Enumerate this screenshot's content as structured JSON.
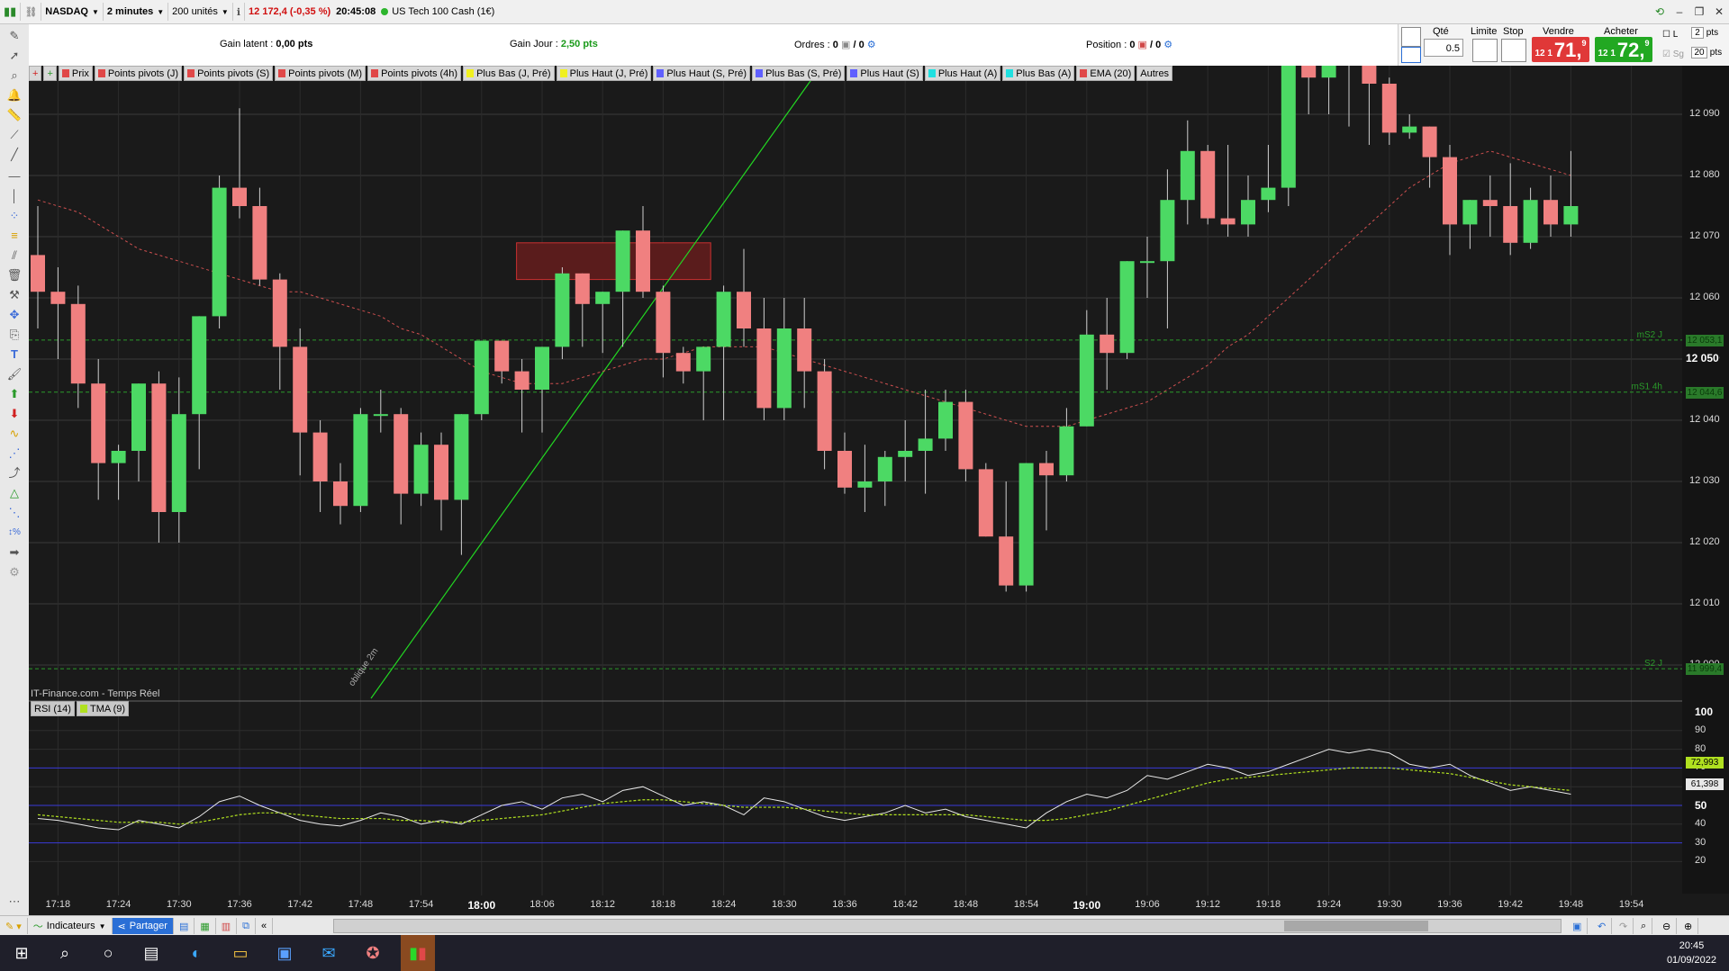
{
  "topbar": {
    "exchange": "NASDAQ",
    "timeframe": "2 minutes",
    "units": "200 unités",
    "price_change": "12 172,4 (-0,35 %)",
    "time": "20:45:08",
    "instrument": "US Tech 100 Cash (1€)"
  },
  "infobar": {
    "gain_latent_label": "Gain latent :",
    "gain_latent_value": "0,00 pts",
    "gain_jour_label": "Gain Jour :",
    "gain_jour_value": "2,50 pts",
    "ordres_label": "Ordres :",
    "ordres_value1": "0",
    "ordres_value2": "/ 0",
    "position_label": "Position :",
    "position_value1": "0",
    "position_value2": "/ 0"
  },
  "order_panel": {
    "qte_label": "Qté",
    "qte_value": "0.5",
    "limite_label": "Limite",
    "stop_label": "Stop",
    "vendre_label": "Vendre",
    "acheter_label": "Acheter",
    "sell_small": "12 1",
    "sell_big": "71,",
    "sell_sup": "9",
    "buy_small": "12 1",
    "buy_big": "72,",
    "buy_sup": "9",
    "opt_l": "L",
    "opt_sg": "Sg",
    "pts1_value": "2",
    "pts1_label": "pts",
    "pts2_value": "20",
    "pts2_label": "pts"
  },
  "tags": [
    {
      "label": "Prix",
      "color": "#e04848"
    },
    {
      "label": "Points pivots (J)",
      "color": "#e04848"
    },
    {
      "label": "Points pivots (S)",
      "color": "#e04848"
    },
    {
      "label": "Points pivots (M)",
      "color": "#e04848"
    },
    {
      "label": "Points pivots (4h)",
      "color": "#e04848"
    },
    {
      "label": "Plus Bas (J, Pré)",
      "color": "#f0f020"
    },
    {
      "label": "Plus Haut (J, Pré)",
      "color": "#f0f020"
    },
    {
      "label": "Plus Haut (S, Pré)",
      "color": "#6060ff"
    },
    {
      "label": "Plus Bas (S, Pré)",
      "color": "#6060ff"
    },
    {
      "label": "Plus Haut (S)",
      "color": "#6060ff"
    },
    {
      "label": "Plus Haut (A)",
      "color": "#20e0e0"
    },
    {
      "label": "Plus Bas (A)",
      "color": "#20e0e0"
    },
    {
      "label": "EMA (20)",
      "color": "#e04848"
    },
    {
      "label": "Autres",
      "color": ""
    }
  ],
  "chart": {
    "watermark": "IT-Finance.com - Temps Réel",
    "line_label": "oblique 2m",
    "level_labels": [
      "mS2 J",
      "mS1 4h",
      "S2 J"
    ],
    "price_badges": [
      "12 053,1",
      "12 044,6",
      "11 999,4"
    ],
    "y_labels": [
      "12 090",
      "12 080",
      "12 070",
      "12 060",
      "12 050",
      "12 040",
      "12 030",
      "12 020",
      "12 010",
      "12 000"
    ],
    "rsi_labels": [
      "100",
      "90",
      "80",
      "70",
      "60",
      "50",
      "40",
      "30",
      "20"
    ],
    "rsi_badges": [
      "72,993",
      "61,398"
    ],
    "x_labels": [
      "17:18",
      "17:24",
      "17:30",
      "17:36",
      "17:42",
      "17:48",
      "17:54",
      "18:00",
      "18:06",
      "18:12",
      "18:18",
      "18:24",
      "18:30",
      "18:36",
      "18:42",
      "18:48",
      "18:54",
      "19:00",
      "19:06",
      "19:12",
      "19:18",
      "19:24",
      "19:30",
      "19:36",
      "19:42",
      "19:48",
      "19:54"
    ],
    "bold_x": [
      "18:00",
      "19:00"
    ]
  },
  "rsi_tags": [
    {
      "label": "RSI (14)",
      "color": ""
    },
    {
      "label": "TMA (9)",
      "color": "#b0e020"
    }
  ],
  "bottombar": {
    "indicateurs": "Indicateurs",
    "partager": "Partager"
  },
  "taskbar": {
    "time": "20:45",
    "date": "01/09/2022"
  },
  "colors": {
    "bull": "#4cd964",
    "bear": "#f08080",
    "sell": "#e03838",
    "buy": "#22a822"
  },
  "chart_data": {
    "type": "candlestick",
    "x_start": "17:16",
    "interval_minutes": 2,
    "ylim": [
      11995,
      12095
    ],
    "candles": [
      [
        12067,
        12075,
        12055,
        12061
      ],
      [
        12061,
        12065,
        12050,
        12059
      ],
      [
        12059,
        12062,
        12042,
        12046
      ],
      [
        12046,
        12050,
        12027,
        12033
      ],
      [
        12033,
        12036,
        12027,
        12035
      ],
      [
        12035,
        12045,
        12030,
        12046
      ],
      [
        12046,
        12048,
        12020,
        12025
      ],
      [
        12025,
        12047,
        12020,
        12041
      ],
      [
        12041,
        12053,
        12032,
        12057
      ],
      [
        12057,
        12080,
        12055,
        12078
      ],
      [
        12078,
        12091,
        12073,
        12075
      ],
      [
        12075,
        12078,
        12062,
        12063
      ],
      [
        12063,
        12064,
        12045,
        12052
      ],
      [
        12052,
        12055,
        12031,
        12038
      ],
      [
        12038,
        12040,
        12025,
        12030
      ],
      [
        12030,
        12033,
        12023,
        12026
      ],
      [
        12026,
        12042,
        12025,
        12041
      ],
      [
        12041,
        12045,
        12038,
        12041
      ],
      [
        12041,
        12042,
        12023,
        12028
      ],
      [
        12028,
        12038,
        12026,
        12036
      ],
      [
        12036,
        12038,
        12022,
        12027
      ],
      [
        12027,
        12040,
        12018,
        12041
      ],
      [
        12041,
        12052,
        12040,
        12053
      ],
      [
        12053,
        12052,
        12046,
        12048
      ],
      [
        12048,
        12050,
        12038,
        12045
      ],
      [
        12045,
        12050,
        12038,
        12052
      ],
      [
        12052,
        12065,
        12050,
        12064
      ],
      [
        12064,
        12064,
        12052,
        12059
      ],
      [
        12059,
        12060,
        12051,
        12061
      ],
      [
        12061,
        12068,
        12052,
        12071
      ],
      [
        12071,
        12075,
        12060,
        12061
      ],
      [
        12061,
        12062,
        12047,
        12051
      ],
      [
        12051,
        12052,
        12046,
        12048
      ],
      [
        12048,
        12050,
        12040,
        12052
      ],
      [
        12052,
        12062,
        12040,
        12061
      ],
      [
        12061,
        12068,
        12052,
        12055
      ],
      [
        12055,
        12060,
        12040,
        12042
      ],
      [
        12042,
        12060,
        12040,
        12055
      ],
      [
        12055,
        12060,
        12042,
        12048
      ],
      [
        12048,
        12050,
        12032,
        12035
      ],
      [
        12035,
        12038,
        12028,
        12029
      ],
      [
        12029,
        12036,
        12025,
        12030
      ],
      [
        12030,
        12035,
        12026,
        12034
      ],
      [
        12034,
        12040,
        12030,
        12035
      ],
      [
        12035,
        12045,
        12028,
        12037
      ],
      [
        12037,
        12045,
        12035,
        12043
      ],
      [
        12043,
        12045,
        12030,
        12032
      ],
      [
        12032,
        12033,
        12022,
        12021
      ],
      [
        12021,
        12030,
        12012,
        12013
      ],
      [
        12013,
        12032,
        12012,
        12033
      ],
      [
        12033,
        12035,
        12022,
        12031
      ],
      [
        12031,
        12042,
        12030,
        12039
      ],
      [
        12039,
        12058,
        12039,
        12054
      ],
      [
        12054,
        12060,
        12045,
        12051
      ],
      [
        12051,
        12066,
        12050,
        12066
      ],
      [
        12066,
        12070,
        12060,
        12066
      ],
      [
        12066,
        12081,
        12055,
        12076
      ],
      [
        12076,
        12089,
        12072,
        12084
      ],
      [
        12084,
        12085,
        12072,
        12073
      ],
      [
        12073,
        12085,
        12070,
        12072
      ],
      [
        12072,
        12080,
        12070,
        12076
      ],
      [
        12076,
        12085,
        12074,
        12078
      ],
      [
        12078,
        12095,
        12075,
        12098
      ],
      [
        12098,
        12100,
        12090,
        12096
      ],
      [
        12096,
        12100,
        12090,
        12100
      ],
      [
        12100,
        12102,
        12088,
        12100
      ],
      [
        12100,
        12102,
        12085,
        12095
      ],
      [
        12095,
        12096,
        12085,
        12087
      ],
      [
        12087,
        12090,
        12086,
        12088
      ],
      [
        12088,
        12087,
        12078,
        12083
      ],
      [
        12083,
        12085,
        12067,
        12072
      ],
      [
        12072,
        12075,
        12068,
        12076
      ],
      [
        12076,
        12080,
        12070,
        12075
      ],
      [
        12075,
        12082,
        12067,
        12069
      ],
      [
        12069,
        12078,
        12068,
        12076
      ],
      [
        12076,
        12080,
        12070,
        12072
      ],
      [
        12072,
        12084,
        12070,
        12075
      ]
    ],
    "ema20": [
      12076,
      12075,
      12074,
      12072,
      12070,
      12068,
      12067,
      12066,
      12065,
      12064,
      12063,
      12062,
      12061,
      12061,
      12060,
      12059,
      12058,
      12057,
      12055,
      12054,
      12052,
      12050,
      12048,
      12047,
      12046,
      12046,
      12046,
      12047,
      12048,
      12049,
      12050,
      12050,
      12051,
      12052,
      12052,
      12052,
      12052,
      12051,
      12050,
      12049,
      12048,
      12047,
      12046,
      12045,
      12044,
      12043,
      12042,
      12041,
      12040,
      12039,
      12039,
      12039,
      12040,
      12041,
      12042,
      12043,
      12045,
      12047,
      12049,
      12052,
      12054,
      12057,
      12060,
      12063,
      12066,
      12069,
      12072,
      12075,
      12078,
      12080,
      12082,
      12083,
      12084,
      12083,
      12082,
      12081,
      12080
    ],
    "rsi": [
      43,
      42,
      40,
      38,
      37,
      42,
      40,
      38,
      44,
      52,
      55,
      50,
      46,
      42,
      40,
      39,
      42,
      46,
      44,
      40,
      42,
      40,
      45,
      50,
      52,
      48,
      54,
      56,
      52,
      58,
      60,
      55,
      50,
      52,
      50,
      45,
      54,
      52,
      48,
      44,
      42,
      44,
      46,
      50,
      46,
      48,
      44,
      42,
      40,
      38,
      46,
      52,
      56,
      54,
      58,
      66,
      64,
      68,
      72,
      70,
      66,
      68,
      72,
      76,
      80,
      78,
      80,
      78,
      72,
      70,
      72,
      66,
      62,
      58,
      60,
      58,
      56
    ],
    "tma9": [
      45,
      44,
      43,
      42,
      41,
      41,
      41,
      40,
      41,
      43,
      45,
      46,
      46,
      45,
      44,
      43,
      43,
      43,
      42,
      42,
      41,
      41,
      42,
      43,
      44,
      45,
      47,
      49,
      51,
      52,
      53,
      53,
      52,
      51,
      50,
      49,
      49,
      49,
      48,
      47,
      46,
      45,
      45,
      45,
      45,
      45,
      45,
      44,
      43,
      42,
      42,
      43,
      45,
      47,
      50,
      53,
      56,
      59,
      62,
      64,
      65,
      66,
      67,
      68,
      69,
      70,
      70,
      70,
      69,
      68,
      67,
      65,
      63,
      61,
      60,
      59,
      58
    ]
  }
}
